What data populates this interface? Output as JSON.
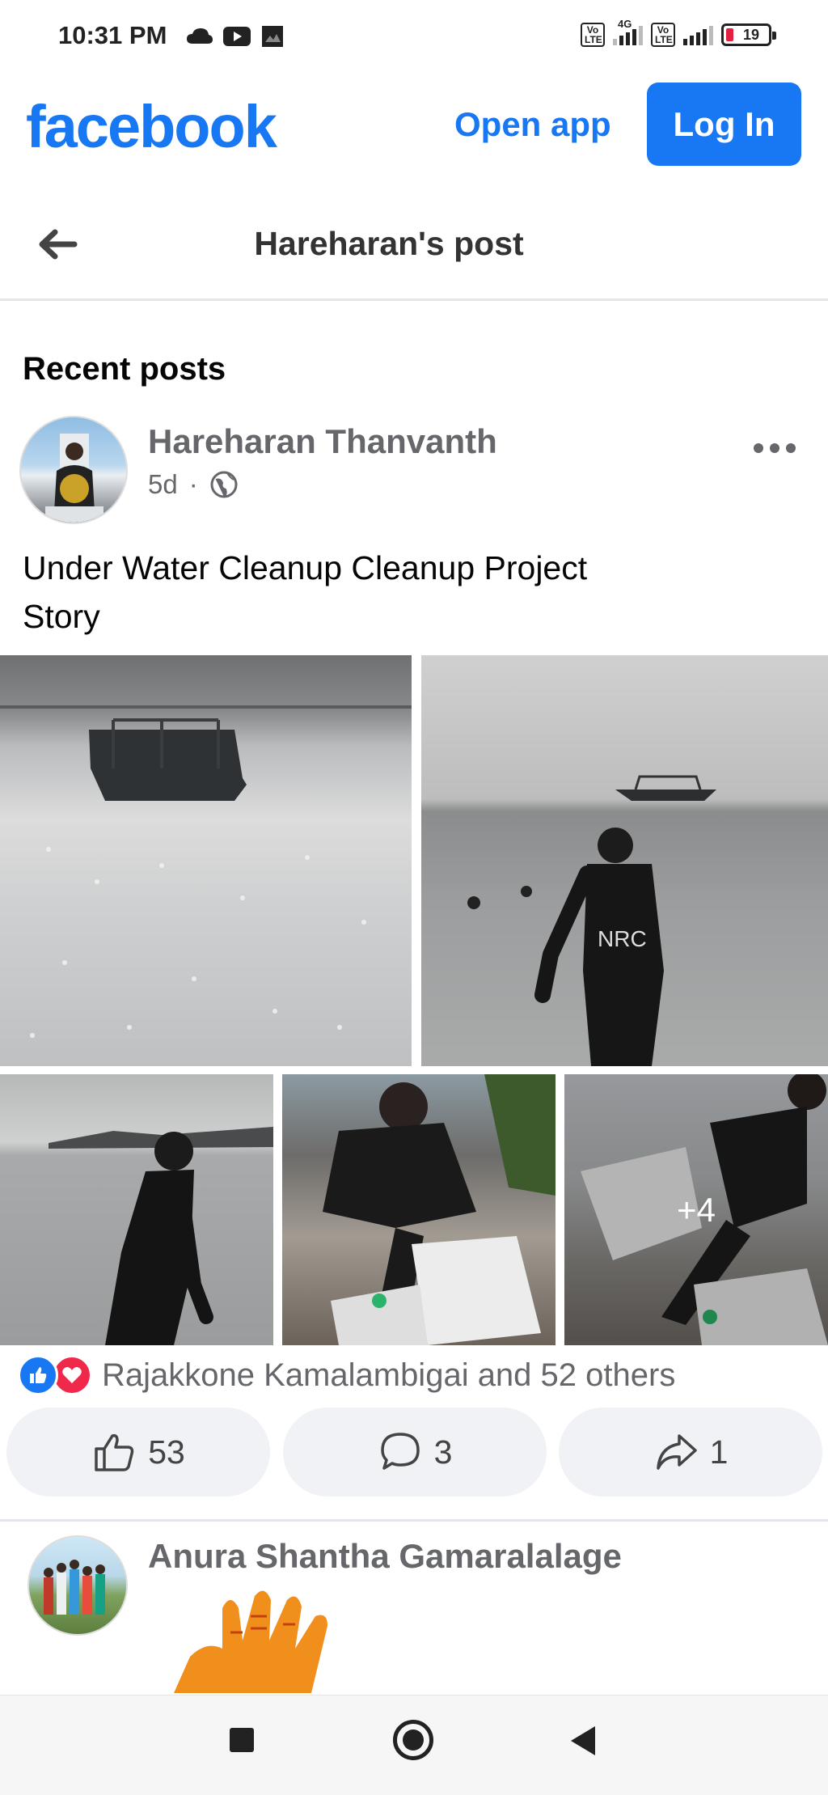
{
  "status_bar": {
    "time": "10:31 PM",
    "left_icons": [
      "cloud-icon",
      "youtube-icon",
      "gallery-icon"
    ],
    "network_type": "4G",
    "volte_label": "Vo LTE",
    "battery": "19"
  },
  "header": {
    "logo": "facebook",
    "open_app_label": "Open app",
    "login_label": "Log In",
    "brand_color": "#1877f2"
  },
  "post_nav": {
    "back_icon": "arrow-left-icon",
    "title": "Hareharan's post"
  },
  "section_title": "Recent posts",
  "post": {
    "author": "Hareharan Thanvanth",
    "age": "5d",
    "separator": "·",
    "privacy_icon": "globe-icon",
    "text": "Under Water Cleanup Cleanup Project Story",
    "more_photos_label": "+4",
    "reactions_text": "Rajakkone Kamalambigai and 52 others",
    "like_count": "53",
    "comment_count": "3",
    "share_count": "1"
  },
  "post2": {
    "author": "Anura Shantha Gamaralalage"
  },
  "nav_bar": {
    "items": [
      "recents-icon",
      "home-icon",
      "back-icon"
    ]
  }
}
